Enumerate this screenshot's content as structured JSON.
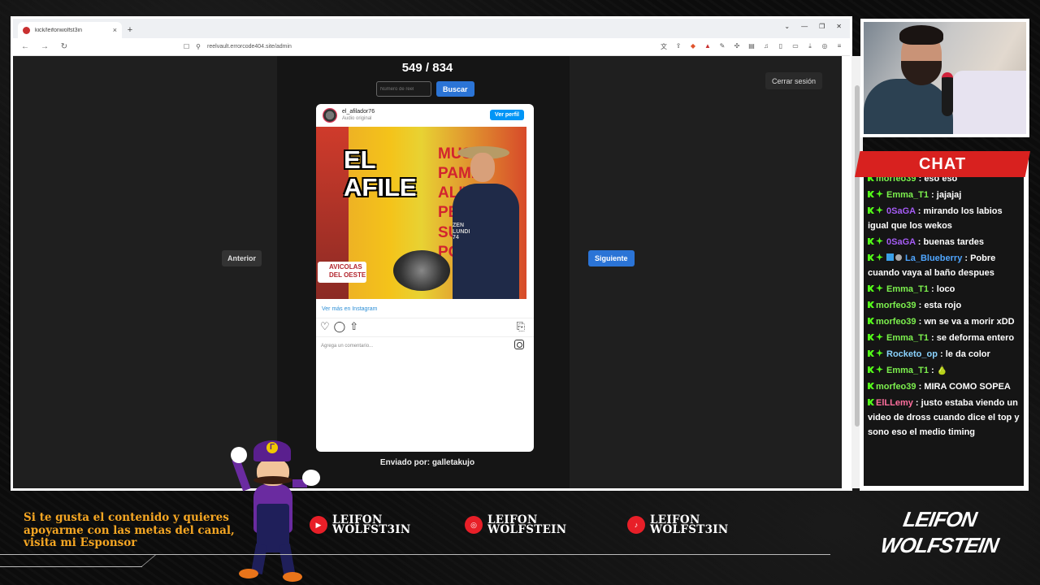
{
  "browser": {
    "tab_title": "kick/leifonwolfst3in",
    "tab_close": "×",
    "new_tab": "+",
    "url": "reelvault.errorcode404.site/admin"
  },
  "page": {
    "counter": "549 / 834",
    "search_placeholder": "Número de reel",
    "search_button": "Buscar",
    "logout_button": "Cerrar sesión",
    "prev_button": "Anterior",
    "next_button": "Siguiente",
    "sent_by": "Enviado por: galletakujo"
  },
  "instagram": {
    "username": "el_afilador76",
    "audio": "Audio original",
    "view_profile": "Ver perfil",
    "overlay_line1": "EL",
    "overlay_line2": "AFILE",
    "shop_text": "MUSL\nPAMPE\nALITAS\nPECHU\nSUPR\nPOL",
    "shirt_text": "ZEN\nLUNDI\n74",
    "sign_text": "AVICOLAS\nDEL OESTE",
    "view_more": "Ver más en Instagram",
    "comment_placeholder": "Agrega un comentario..."
  },
  "chat": {
    "title": "CHAT",
    "messages": [
      {
        "user": "morfeo39",
        "text": "eso eso",
        "color": "u-green"
      },
      {
        "user": "Emma_T1",
        "text": "jajajaj",
        "color": "u-green"
      },
      {
        "user": "0SaGA",
        "text": "mirando los labios igual que los wekos",
        "color": "u-purple"
      },
      {
        "user": "0SaGA",
        "text": "buenas tardes",
        "color": "u-purple"
      },
      {
        "user": "La_Blueberry",
        "text": "Pobre cuando vaya al baño despues",
        "color": "u-blue"
      },
      {
        "user": "Emma_T1",
        "text": "loco",
        "color": "u-green"
      },
      {
        "user": "morfeo39",
        "text": "esta rojo",
        "color": "u-green"
      },
      {
        "user": "morfeo39",
        "text": "wn se va a morir xDD",
        "color": "u-green"
      },
      {
        "user": "Emma_T1",
        "text": "se deforma entero",
        "color": "u-green"
      },
      {
        "user": "Rocketo_op",
        "text": "le da color",
        "color": "u-cyan"
      },
      {
        "user": "Emma_T1",
        "text": "🍐",
        "color": "u-green"
      },
      {
        "user": "morfeo39",
        "text": "MIRA COMO SOPEA",
        "color": "u-green"
      },
      {
        "user": "ElLLemy",
        "text": "justo estaba viendo un video de dross cuando dice el top y sono eso el medio timing",
        "color": "u-pink"
      }
    ]
  },
  "overlay": {
    "promo_line1": "Si te gusta el contenido y quieres",
    "promo_line2": "apoyarme con las metas del canal,",
    "promo_line3": "visita mi Esponsor",
    "youtube_name_1": "LEIFON",
    "youtube_name_2": "WOLFST3IN",
    "instagram_name_1": "LEIFON",
    "instagram_name_2": "WOLFSTEIN",
    "tiktok_name_1": "LEIFON",
    "tiktok_name_2": "WOLFST3IN",
    "brand_line1": "LEIFON",
    "brand_line2": "WOLFSTEIN"
  },
  "colors": {
    "accent_blue": "#2b74d6",
    "chat_red": "#d8211f",
    "promo_orange": "#f5a623",
    "kick_green": "#53fc18"
  }
}
